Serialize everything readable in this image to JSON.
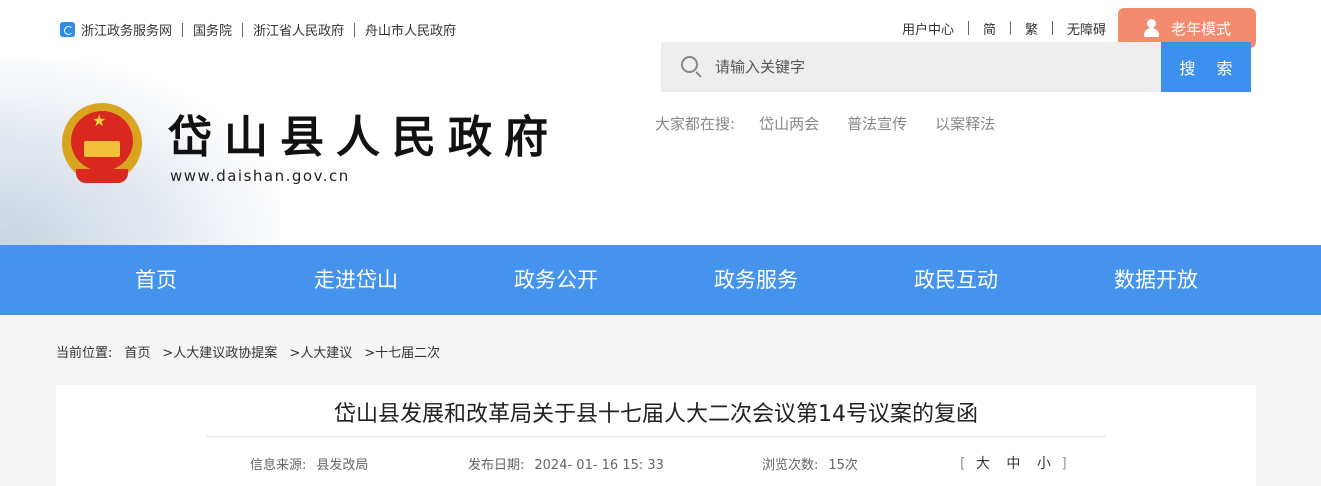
{
  "topbar": {
    "left_links": [
      "浙江政务服务网",
      "国务院",
      "浙江省人民政府",
      "舟山市人民政府"
    ],
    "right_links": [
      "用户中心",
      "简",
      "繁",
      "无障碍"
    ],
    "elder_mode": "老年模式"
  },
  "header": {
    "site_title": "岱山县人民政府",
    "site_url": "www.daishan.gov.cn",
    "search_placeholder": "请输入关键字",
    "search_button": "搜 索",
    "hot_label": "大家都在搜:",
    "hot_items": [
      "岱山两会",
      "普法宣传",
      "以案释法"
    ]
  },
  "nav": {
    "items": [
      "首页",
      "走进岱山",
      "政务公开",
      "政务服务",
      "政民互动",
      "数据开放"
    ]
  },
  "breadcrumb": {
    "label": "当前位置:",
    "items": [
      "首页",
      ">人大建议政协提案",
      ">人大建议",
      ">十七届二次"
    ]
  },
  "article": {
    "title": "岱山县发展和改革局关于县十七届人大二次会议第14号议案的复函",
    "source_label": "信息来源:",
    "source_value": "县发改局",
    "date_label": "发布日期:",
    "date_value": "2024- 01- 16 15: 33",
    "views_label": "浏览次数:",
    "views_value": "15次",
    "font_open": "[",
    "font_large": "大",
    "font_medium": "中",
    "font_small": "小",
    "font_close": "]"
  },
  "colors": {
    "nav_bg": "#4593ec",
    "search_button": "#3d90ee",
    "elder_button": "#f38b6e"
  }
}
